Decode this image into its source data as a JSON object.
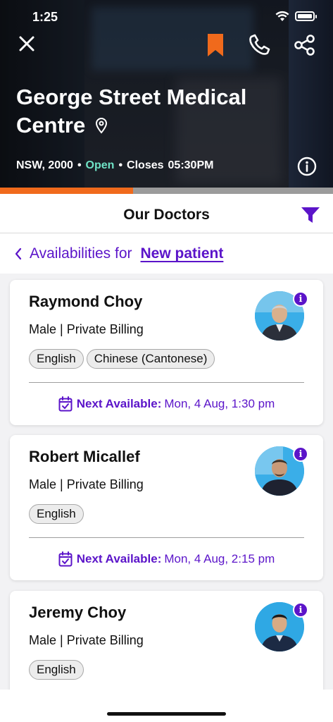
{
  "status_bar": {
    "time": "1:25"
  },
  "clinic": {
    "name": "George Street Medical Centre",
    "location": "NSW, 2000",
    "open_status": "Open",
    "closes_label": "Closes",
    "closes_time": "05:30PM",
    "progress_fraction": 0.4
  },
  "colors": {
    "accent": "#5b14c9",
    "bookmark": "#f06a1c",
    "open": "#6fe3c6",
    "progress": "#f06a1c"
  },
  "header": {
    "title": "Our Doctors"
  },
  "availability": {
    "label": "Availabilities for",
    "patient_type": "New patient"
  },
  "doctors": [
    {
      "name": "Raymond Choy",
      "meta": "Male | Private Billing",
      "languages": [
        "English",
        "Chinese (Cantonese)"
      ],
      "next_label": "Next Available:",
      "next_value": "Mon, 4 Aug,  1:30 pm"
    },
    {
      "name": "Robert Micallef",
      "meta": "Male | Private Billing",
      "languages": [
        "English"
      ],
      "next_label": "Next Available:",
      "next_value": "Mon, 4 Aug,  2:15 pm"
    },
    {
      "name": "Jeremy Choy",
      "meta": "Male | Private Billing",
      "languages": [
        "English"
      ],
      "next_label": "",
      "next_value": ""
    }
  ],
  "icons": {
    "close": "close-icon",
    "bookmark": "bookmark-icon",
    "phone": "phone-icon",
    "share": "share-icon",
    "pin": "location-pin-icon",
    "info": "info-icon",
    "filter": "filter-icon",
    "back": "chevron-left-icon",
    "calendar": "calendar-check-icon"
  }
}
